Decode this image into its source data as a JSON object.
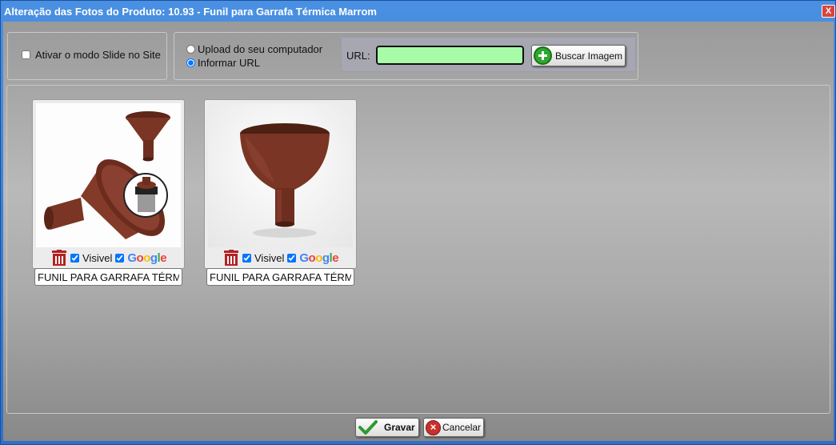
{
  "window": {
    "title": "Alteração das Fotos do Produto: 10.93 - Funil para Garrafa Térmica Marrom",
    "close_label": "X"
  },
  "slide_option": {
    "label": "Ativar o modo Slide no Site",
    "checked": false
  },
  "upload": {
    "option_computer": "Upload do seu computador",
    "option_url": "Informar URL",
    "selected": "Informar URL",
    "url_label": "URL:",
    "url_value": "",
    "search_button": "Buscar Imagem"
  },
  "photos": [
    {
      "visible_label": "Visivel",
      "visible_checked": true,
      "google_label": "Google",
      "google_checked": true,
      "caption": "FUNIL PARA GARRAFA TÉRMICA MARROM"
    },
    {
      "visible_label": "Visivel",
      "visible_checked": true,
      "google_label": "Google",
      "google_checked": true,
      "caption": "FUNIL PARA GARRAFA TÉRMICA MARROM"
    }
  ],
  "footer": {
    "save_button": "Gravar",
    "cancel_button": "Cancelar"
  },
  "colors": {
    "title_bar": "#3a7bd5",
    "url_field": "#a8fca8",
    "funnel_brown": "#7a3524",
    "delete_red": "#b22222"
  }
}
